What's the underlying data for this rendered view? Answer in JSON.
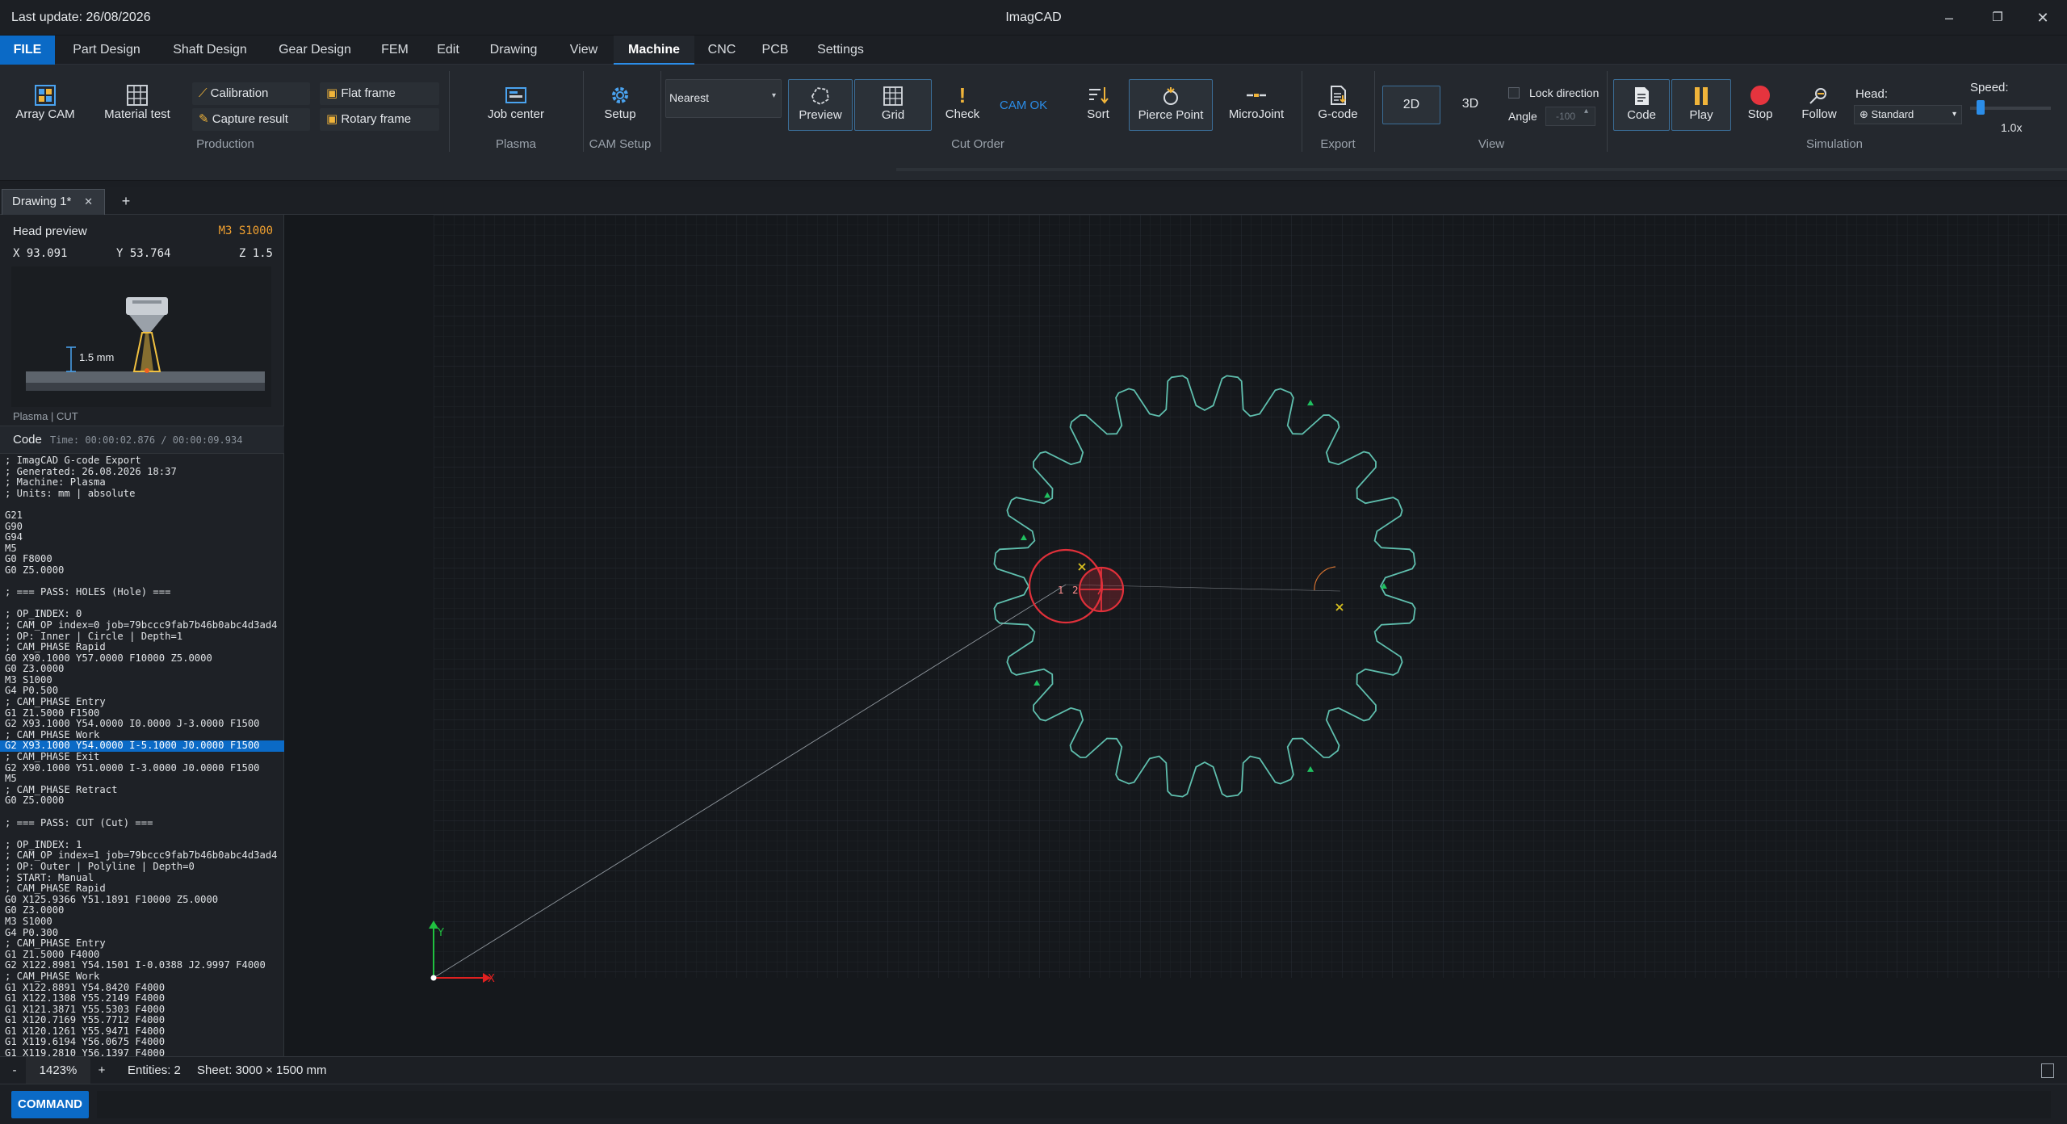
{
  "titlebar": {
    "last_update": "Last update: 26/08/2026",
    "app_title": "ImagCAD"
  },
  "menu": [
    "FILE",
    "Part Design",
    "Shaft Design",
    "Gear Design",
    "FEM",
    "Edit",
    "Drawing",
    "View",
    "Machine",
    "CNC",
    "PCB",
    "Settings"
  ],
  "menu_active": "Machine",
  "ribbon": {
    "array_cam": "Array CAM",
    "material_test": "Material test",
    "calibration": "Calibration",
    "capture_result": "Capture result",
    "flat_frame": "Flat frame",
    "rotary_frame": "Rotary frame",
    "production_group": "Production",
    "job_center": "Job center",
    "plasma_group": "Plasma",
    "setup": "Setup",
    "cam_setup_group": "CAM Setup",
    "nearest_select": "Nearest",
    "preview": "Preview",
    "grid": "Grid",
    "check": "Check",
    "cam_ok": "CAM OK",
    "cut_order_group": "Cut Order",
    "sort": "Sort",
    "pierce_point": "Pierce Point",
    "microjoint": "MicroJoint",
    "gcode": "G-code",
    "export_group": "Export",
    "view_2d": "2D",
    "view_3d": "3D",
    "lock_direction": "Lock direction",
    "angle_label": "Angle",
    "angle_value": "-100",
    "view_group": "View",
    "code": "Code",
    "play": "Play",
    "stop": "Stop",
    "follow": "Follow",
    "head_label": "Head:",
    "head_value": "Standard",
    "speed_label": "Speed:",
    "speed_value": "1.0x",
    "simulation_group": "Simulation"
  },
  "tabs": {
    "doc_tab": "Drawing 1*",
    "add": "+"
  },
  "head_preview": {
    "title": "Head preview",
    "status": "M3 S1000",
    "x": "X 93.091",
    "y": "Y 53.764",
    "z": "Z 1.5",
    "gap": "1.5 mm",
    "mode": "Plasma | CUT"
  },
  "code_panel": {
    "title": "Code",
    "time": "Time: 00:00:02.876 / 00:00:09.934",
    "highlight_index": 26,
    "lines": [
      "; ImagCAD G-code Export",
      "; Generated: 26.08.2026 18:37",
      "; Machine: Plasma",
      "; Units: mm | absolute",
      "",
      "G21",
      "G90",
      "G94",
      "M5",
      "G0 F8000",
      "G0 Z5.0000",
      "",
      "; === PASS: HOLES (Hole) ===",
      "",
      "; OP_INDEX: 0",
      "; CAM_OP index=0 job=79bccc9fab7b46b0abc4d3ad4",
      "; OP: Inner | Circle | Depth=1",
      "; CAM_PHASE Rapid",
      "G0 X90.1000 Y57.0000 F10000 Z5.0000",
      "G0 Z3.0000",
      "M3 S1000",
      "G4 P0.500",
      "; CAM_PHASE Entry",
      "G1 Z1.5000 F1500",
      "G2 X93.1000 Y54.0000 I0.0000 J-3.0000 F1500",
      "; CAM_PHASE Work",
      "G2 X93.1000 Y54.0000 I-5.1000 J0.0000 F1500",
      "; CAM_PHASE Exit",
      "G2 X90.1000 Y51.0000 I-3.0000 J0.0000 F1500",
      "M5",
      "; CAM_PHASE Retract",
      "G0 Z5.0000",
      "",
      "; === PASS: CUT (Cut) ===",
      "",
      "; OP_INDEX: 1",
      "; CAM_OP index=1 job=79bccc9fab7b46b0abc4d3ad4",
      "; OP: Outer | Polyline | Depth=0",
      "; START: Manual",
      "; CAM_PHASE Rapid",
      "G0 X125.9366 Y51.1891 F10000 Z5.0000",
      "G0 Z3.0000",
      "M3 S1000",
      "G4 P0.300",
      "; CAM_PHASE Entry",
      "G1 Z1.5000 F4000",
      "G2 X122.8981 Y54.1501 I-0.0388 J2.9997 F4000",
      "; CAM_PHASE Work",
      "G1 X122.8891 Y54.8420 F4000",
      "G1 X122.1308 Y55.2149 F4000",
      "G1 X121.3871 Y55.5303 F4000",
      "G1 X120.7169 Y55.7712 F4000",
      "G1 X120.1261 Y55.9471 F4000",
      "G1 X119.6194 Y56.0675 F4000",
      "G1 X119.2810 Y56.1397 F4000"
    ]
  },
  "canvas": {
    "axis_x": "X",
    "axis_y": "Y",
    "label_1": "1",
    "label_2": "2",
    "colors": {
      "gear": "#5fbfae",
      "hole": "#e0303a",
      "grid": "#252b31",
      "axis_x": "#e02020",
      "axis_y": "#20c040",
      "marker": "#d8c020"
    }
  },
  "status": {
    "minus": "-",
    "zoom": "1423%",
    "plus": "+",
    "entities": "Entities: 2",
    "sheet": "Sheet: 3000 × 1500 mm"
  },
  "command": {
    "label": "COMMAND",
    "prompt": "▶"
  }
}
